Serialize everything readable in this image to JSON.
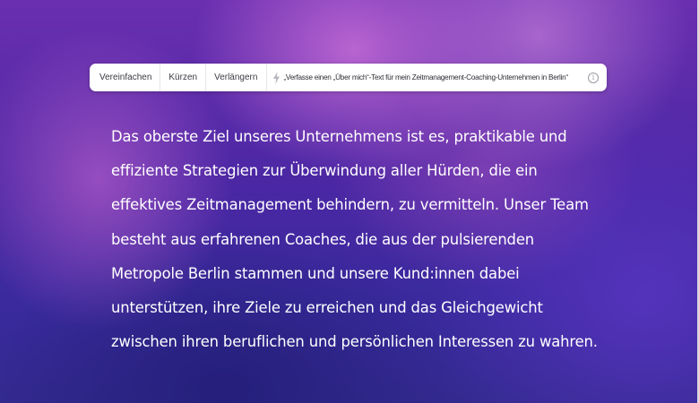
{
  "toolbar": {
    "buttons": [
      "Vereinfachen",
      "Kürzen",
      "Verlängern"
    ],
    "prompt": "„Verfasse einen „Über mich“-Text für mein Zeitmanagement-Coaching-Unternehmen in Berlin“",
    "icons": {
      "prompt": "lightning-icon",
      "info": "info-icon"
    }
  },
  "content": {
    "lines": [
      "Das oberste Ziel unseres Unternehmens ist es, praktikable und",
      "effiziente Strategien zur Überwindung aller Hürden, die ein",
      "effektives Zeitmanagement behindern, zu vermitteln. Unser Team",
      "besteht aus erfahrenen Coaches, die aus der pulsierenden",
      "Metropole Berlin stammen und unsere Kund:innen dabei",
      "unterstützen, ihre Ziele zu erreichen und das Gleichgewicht",
      "zwischen ihren beruflichen und persönlichen Interessen zu wahren."
    ]
  },
  "colors": {
    "background_top": "#6a2fb0",
    "background_bottom": "#332a8f",
    "text": "#ffffff",
    "toolbar": "#ffffff"
  }
}
